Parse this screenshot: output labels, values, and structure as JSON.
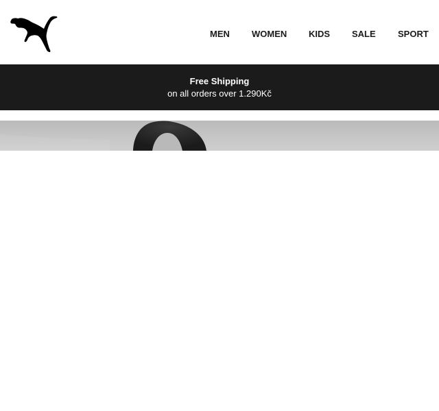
{
  "header": {
    "logo_icon": "puma-cat-logo-icon",
    "nav": [
      {
        "label": "MEN"
      },
      {
        "label": "WOMEN"
      },
      {
        "label": "KIDS"
      },
      {
        "label": "SALE"
      },
      {
        "label": "SPORT"
      }
    ]
  },
  "promo": {
    "title": "Free Shipping",
    "subtitle": "on all orders over 1.290Kč"
  },
  "colors": {
    "promo_background": "#1b1b1b",
    "promo_text": "#ffffff",
    "nav_text": "#1a1a1a"
  }
}
